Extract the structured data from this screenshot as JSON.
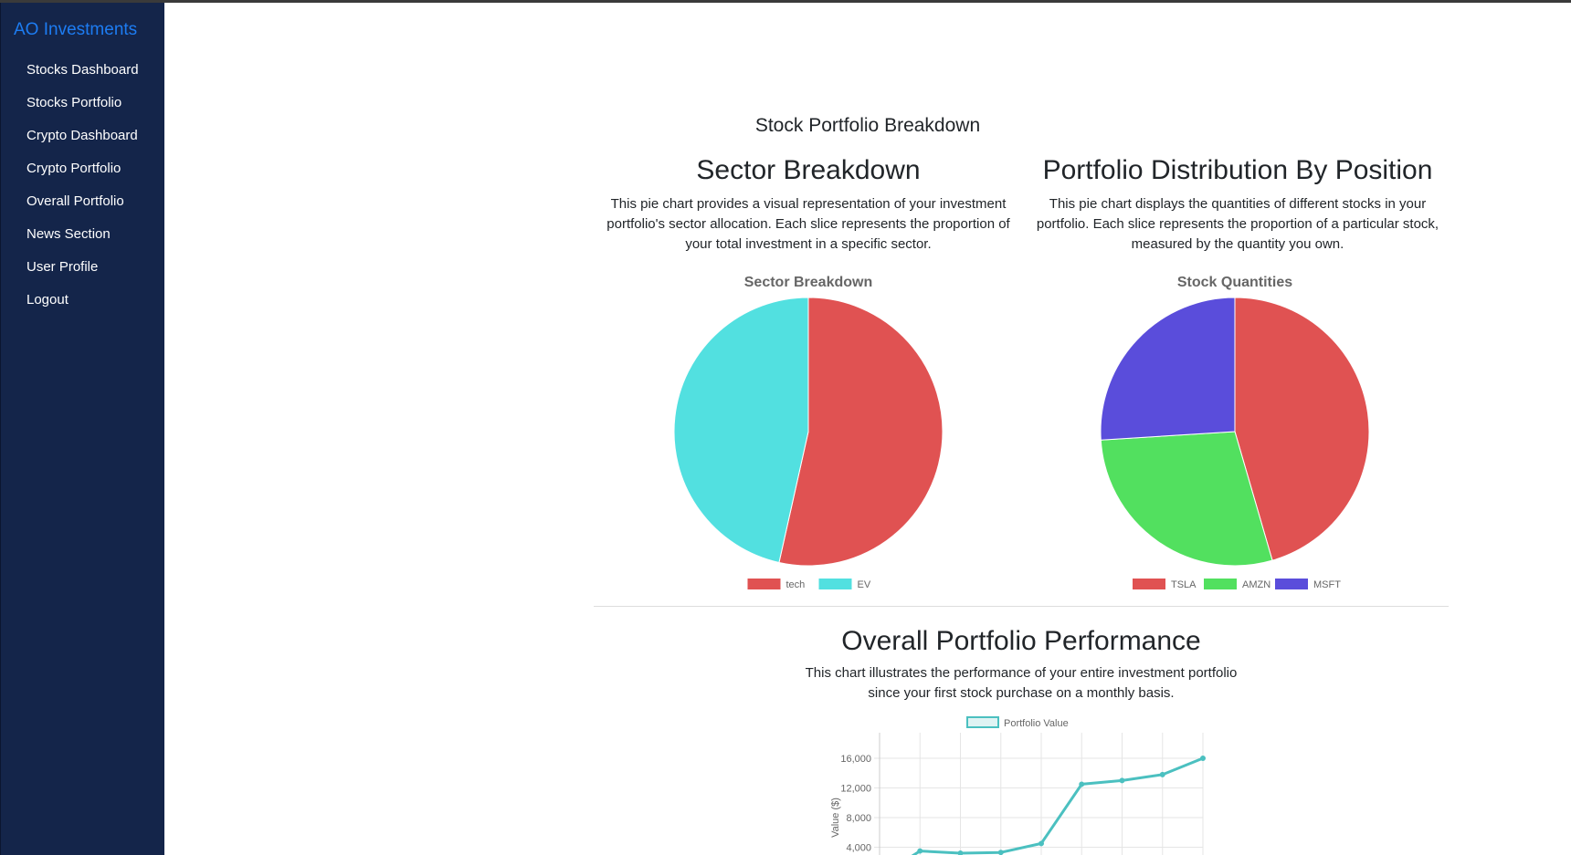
{
  "sidebar": {
    "brand": "AO Investments",
    "items": [
      {
        "label": "Stocks Dashboard"
      },
      {
        "label": "Stocks Portfolio"
      },
      {
        "label": "Crypto Dashboard"
      },
      {
        "label": "Crypto Portfolio"
      },
      {
        "label": "Overall Portfolio"
      },
      {
        "label": "News Section"
      },
      {
        "label": "User Profile"
      },
      {
        "label": "Logout"
      }
    ]
  },
  "main": {
    "heading": "Stock Portfolio Breakdown",
    "sector": {
      "title": "Sector Breakdown",
      "description": "This pie chart provides a visual representation of your investment portfolio's sector allocation. Each slice represents the proportion of your total investment in a specific sector."
    },
    "distribution": {
      "title": "Portfolio Distribution By Position",
      "description": "This pie chart displays the quantities of different stocks in your portfolio. Each slice represents the proportion of a particular stock, measured by the quantity you own."
    },
    "performance": {
      "title": "Overall Portfolio Performance",
      "description": "This chart illustrates the performance of your entire investment portfolio since your first stock purchase on a monthly basis."
    }
  },
  "chart_data": [
    {
      "type": "pie",
      "title": "Sector Breakdown",
      "labels": [
        "tech",
        "EV"
      ],
      "values": [
        53.5,
        46.5
      ],
      "colors": [
        "#e05252",
        "#52e0e0"
      ],
      "legend": "bottom"
    },
    {
      "type": "pie",
      "title": "Stock Quantities",
      "labels": [
        "TSLA",
        "AMZN",
        "MSFT"
      ],
      "values": [
        45.5,
        28.5,
        26
      ],
      "colors": [
        "#e05252",
        "#52e05f",
        "#5a4ddb"
      ],
      "legend": "bottom"
    },
    {
      "type": "line",
      "title": "",
      "series": [
        {
          "name": "Portfolio Value",
          "color": "#4bc0c0",
          "values": [
            0,
            3500,
            3200,
            3300,
            4500,
            12500,
            13000,
            13800,
            16000
          ]
        }
      ],
      "ylabel": "Value ($)",
      "yticks": [
        "4,000",
        "8,000",
        "12,000",
        "16,000"
      ],
      "ylim": [
        0,
        16000
      ],
      "grid": true,
      "legend": "top"
    }
  ]
}
